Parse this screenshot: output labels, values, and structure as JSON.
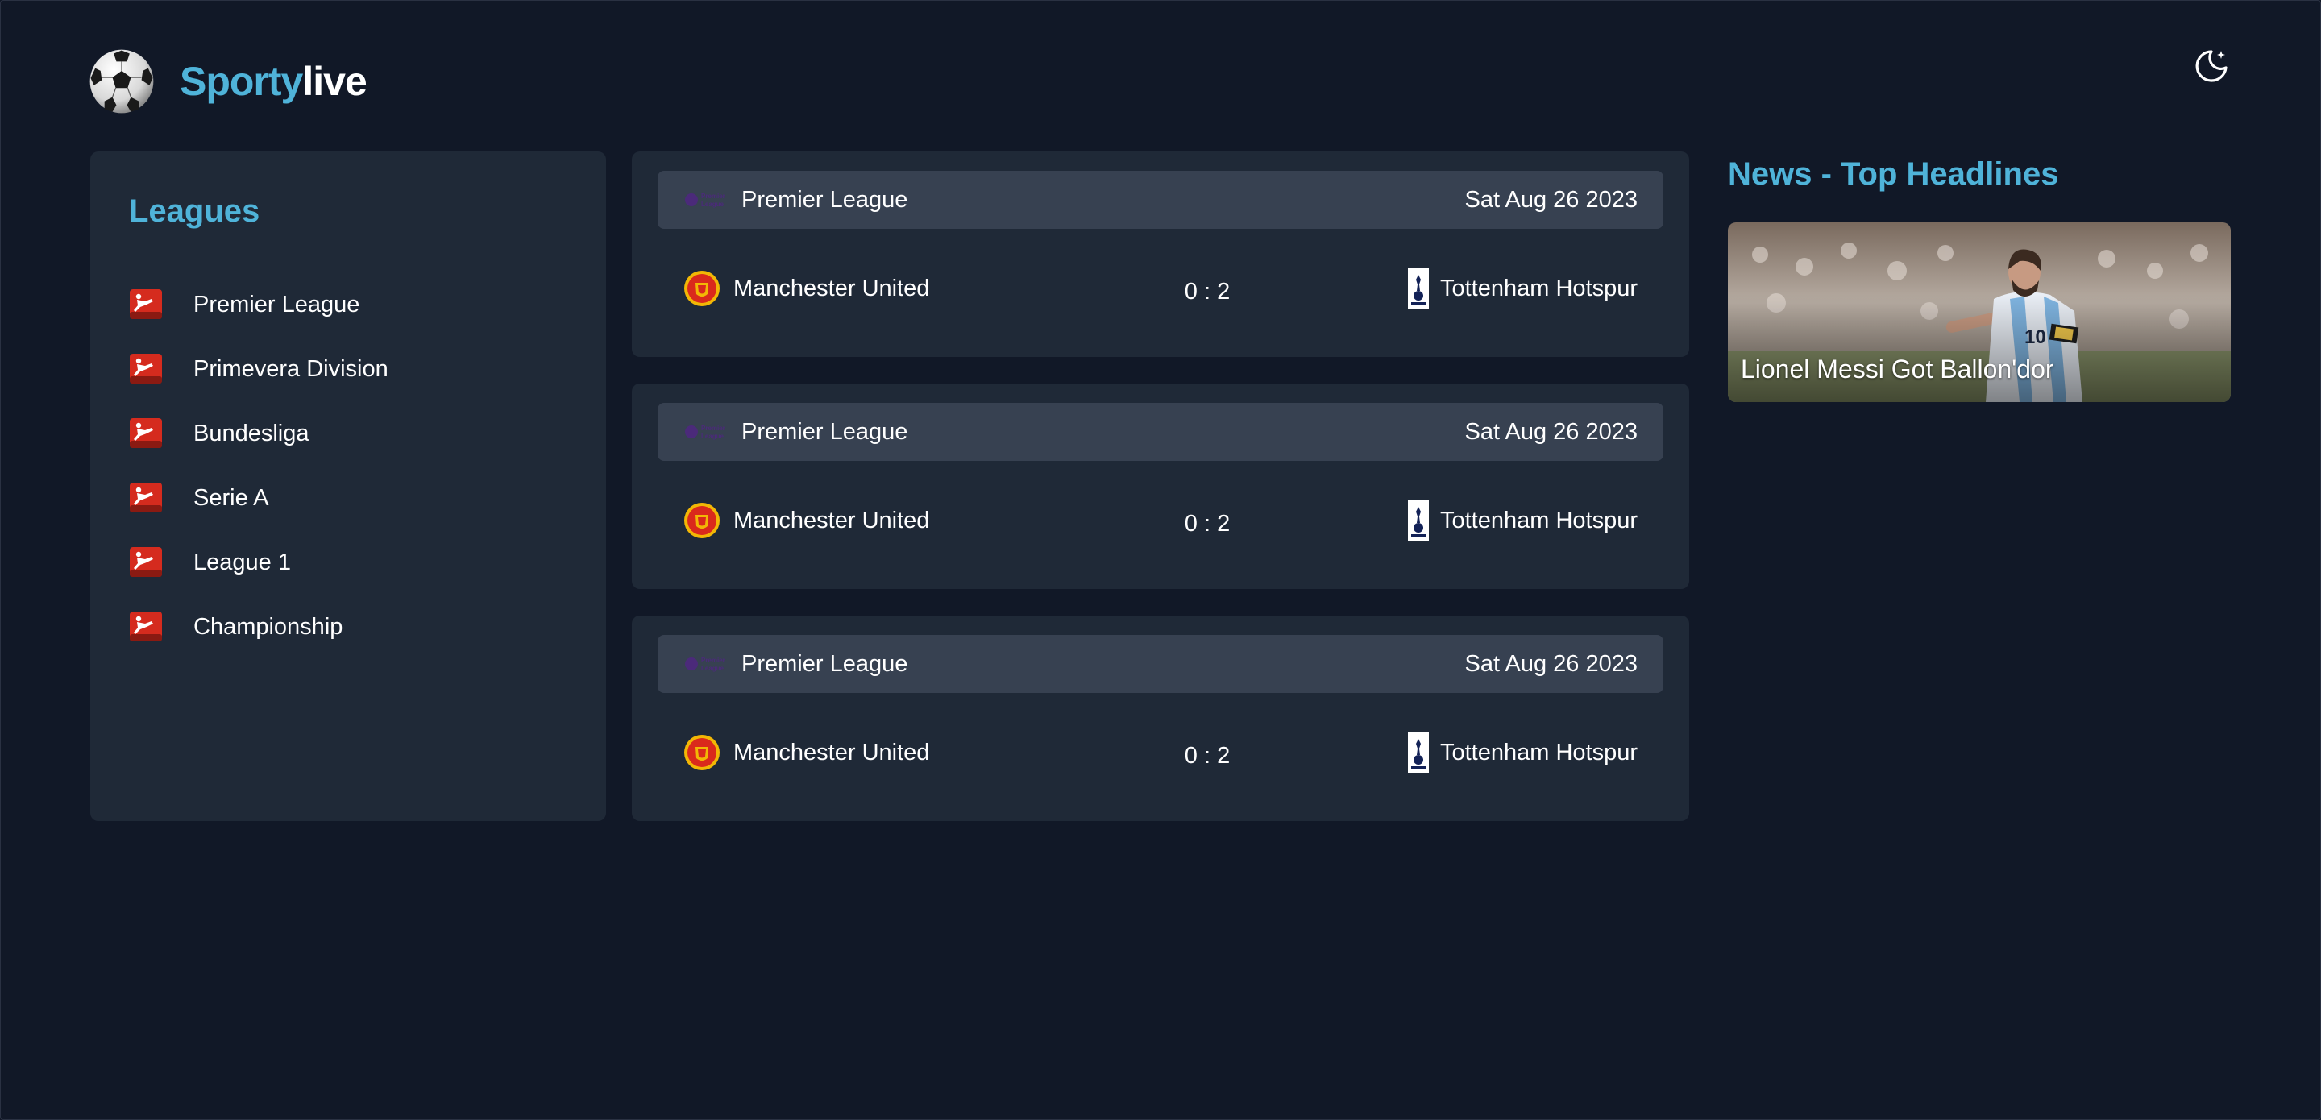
{
  "app": {
    "brand_part1": "Sporty",
    "brand_part2": "live",
    "logo_icon": "soccer-ball-icon",
    "theme_toggle_icon": "moon-icon"
  },
  "leagues": {
    "title": "Leagues",
    "items": [
      {
        "label": "Premier League",
        "icon": "league-flag-icon"
      },
      {
        "label": "Primevera Division",
        "icon": "league-flag-icon"
      },
      {
        "label": "Bundesliga",
        "icon": "league-flag-icon"
      },
      {
        "label": "Serie A",
        "icon": "league-flag-icon"
      },
      {
        "label": "League 1",
        "icon": "league-flag-icon"
      },
      {
        "label": "Championship",
        "icon": "league-flag-icon"
      }
    ]
  },
  "matches": [
    {
      "league": "Premier League",
      "date": "Sat Aug 26 2023",
      "home": "Manchester United",
      "score": "0 : 2",
      "away": "Tottenham Hotspur"
    },
    {
      "league": "Premier League",
      "date": "Sat Aug 26 2023",
      "home": "Manchester United",
      "score": "0 : 2",
      "away": "Tottenham Hotspur"
    },
    {
      "league": "Premier League",
      "date": "Sat Aug 26 2023",
      "home": "Manchester United",
      "score": "0 : 2",
      "away": "Tottenham Hotspur"
    }
  ],
  "news": {
    "title": "News - Top Headlines",
    "items": [
      {
        "headline": "Lionel Messi Got Ballon'dor"
      }
    ]
  },
  "colors": {
    "background": "#111827",
    "panel": "#1f2937",
    "header_bar": "#374151",
    "accent": "#4fb3d9"
  }
}
